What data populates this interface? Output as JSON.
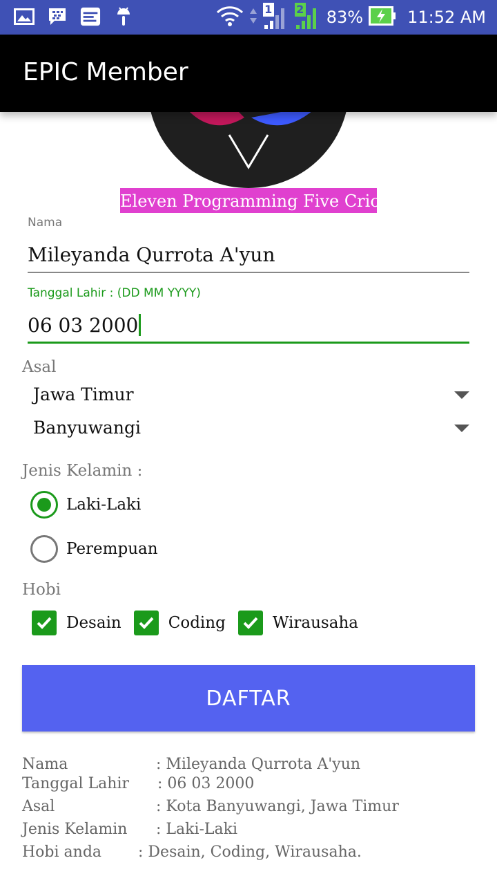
{
  "status_bar": {
    "icons": [
      "gallery-icon",
      "bbm-icon",
      "news-app-icon",
      "android-icon",
      "wifi-icon",
      "signal-sim1-icon",
      "signal-sim2-icon",
      "battery-charging-icon"
    ],
    "sim1_label": "1",
    "sim2_label": "2",
    "battery": "83%",
    "time": "11:52 AM"
  },
  "app_bar": {
    "title": "EPIC Member"
  },
  "logo": {
    "caption": "Eleven Programming Five Crick"
  },
  "form": {
    "nama": {
      "label": "Nama",
      "value": "Mileyanda Qurrota A'yun"
    },
    "tanggal": {
      "label": "Tanggal Lahir : (DD MM YYYY)",
      "value": "06 03 2000"
    },
    "asal": {
      "label": "Asal",
      "provinsi": "Jawa Timur",
      "kota": "Banyuwangi"
    },
    "gender": {
      "label": "Jenis Kelamin :",
      "options": [
        {
          "label": "Laki-Laki",
          "selected": true
        },
        {
          "label": "Perempuan",
          "selected": false
        }
      ]
    },
    "hobi": {
      "label": "Hobi",
      "options": [
        {
          "label": "Desain",
          "checked": true
        },
        {
          "label": "Coding",
          "checked": true
        },
        {
          "label": "Wirausaha",
          "checked": true
        }
      ]
    },
    "submit_label": "DAFTAR"
  },
  "result": {
    "rows": [
      {
        "key": "Nama",
        "value": ": Mileyanda Qurrota A'yun"
      },
      {
        "key": "Tanggal Lahir",
        "value": ": 06 03 2000"
      },
      {
        "key": "Asal",
        "value": ": Kota Banyuwangi, Jawa Timur"
      },
      {
        "key": "Jenis Kelamin",
        "value": ": Laki-Laki"
      },
      {
        "key": "Hobi anda",
        "value": ": Desain, Coding, Wirausaha."
      }
    ]
  },
  "colors": {
    "status_bar": "#3f51b5",
    "app_bar": "#000000",
    "accent": "#1b9a1b",
    "button": "#5462f0",
    "caption_bg": "#e040cf"
  }
}
